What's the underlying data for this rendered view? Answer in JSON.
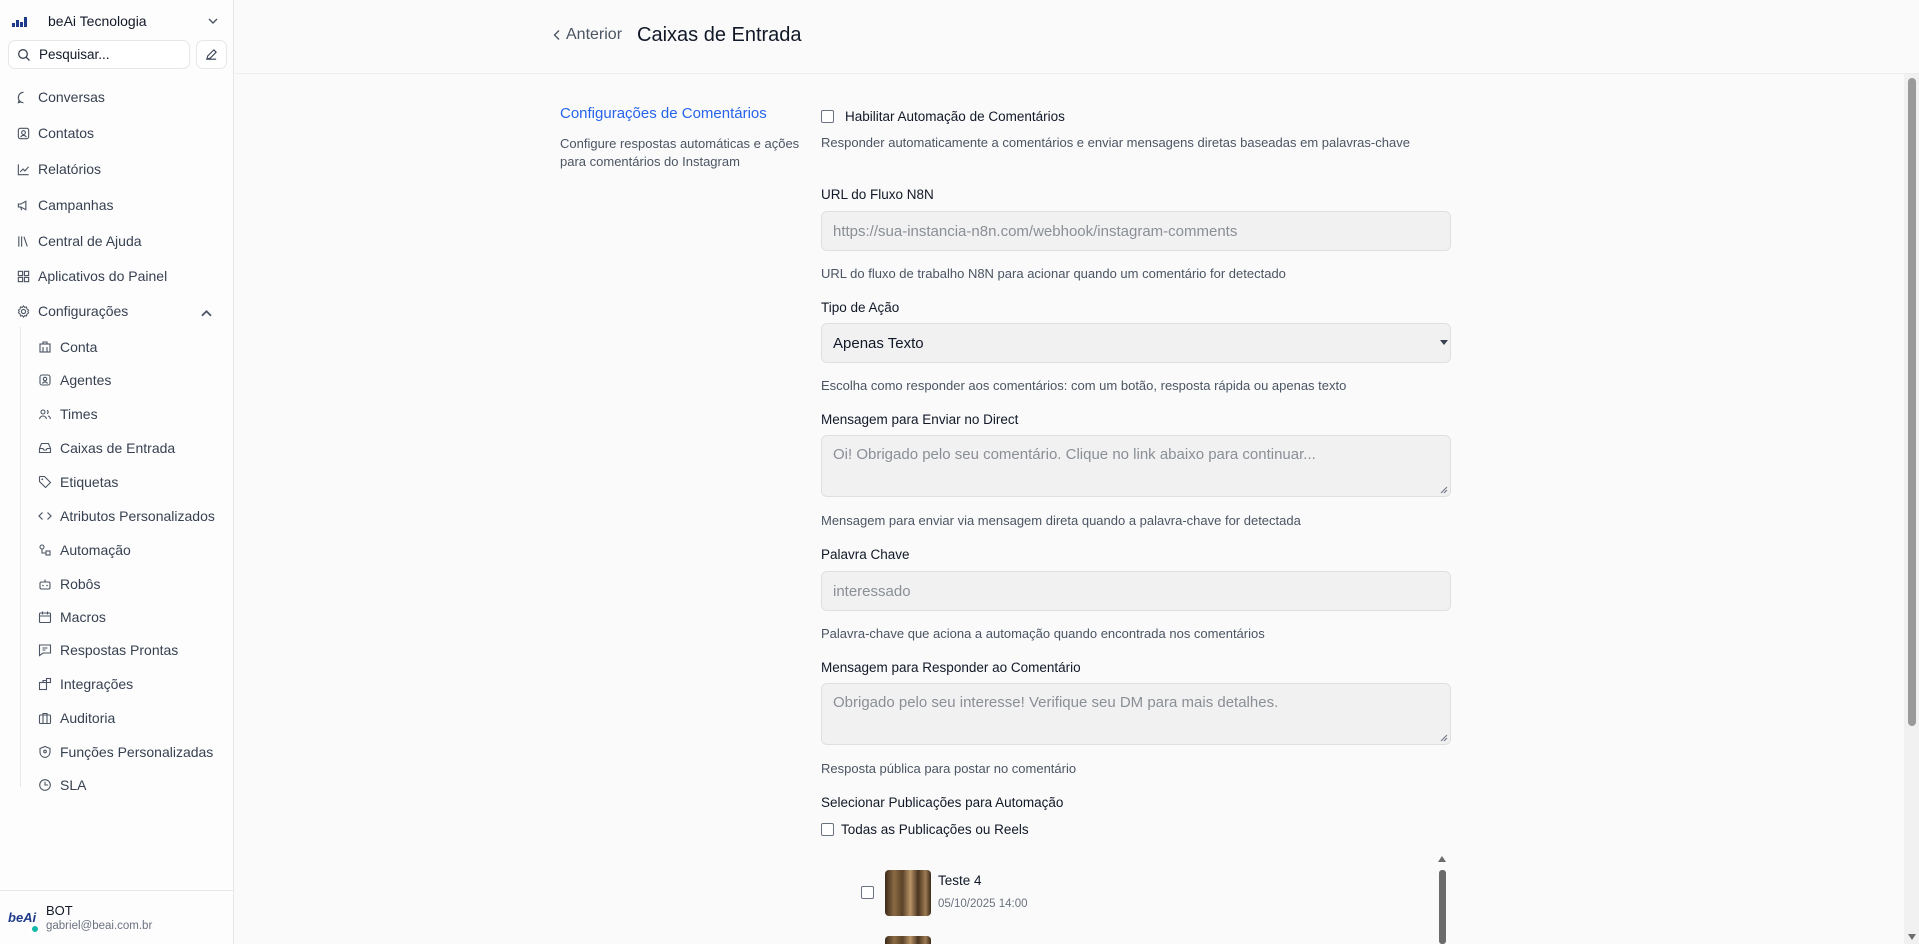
{
  "sidebar": {
    "org_name": "beAi Tecnologia",
    "search_placeholder": "Pesquisar...",
    "nav": [
      {
        "label": "Conversas",
        "icon": "chat-bubble-icon"
      },
      {
        "label": "Contatos",
        "icon": "contact-card-icon"
      },
      {
        "label": "Relatórios",
        "icon": "chart-line-icon"
      },
      {
        "label": "Campanhas",
        "icon": "megaphone-icon"
      },
      {
        "label": "Central de Ajuda",
        "icon": "library-icon"
      },
      {
        "label": "Aplicativos do Painel",
        "icon": "apps-grid-icon"
      },
      {
        "label": "Configurações",
        "icon": "gear-icon"
      }
    ],
    "settings_items": [
      {
        "label": "Conta",
        "icon": "building-icon"
      },
      {
        "label": "Agentes",
        "icon": "agent-icon"
      },
      {
        "label": "Times",
        "icon": "users-icon"
      },
      {
        "label": "Caixas de Entrada",
        "icon": "inbox-icon"
      },
      {
        "label": "Etiquetas",
        "icon": "tag-icon"
      },
      {
        "label": "Atributos Personalizados",
        "icon": "code-icon"
      },
      {
        "label": "Automação",
        "icon": "automation-icon"
      },
      {
        "label": "Robôs",
        "icon": "bot-icon"
      },
      {
        "label": "Macros",
        "icon": "calendar-icon"
      },
      {
        "label": "Respostas Prontas",
        "icon": "message-reply-icon"
      },
      {
        "label": "Integrações",
        "icon": "puzzle-icon"
      },
      {
        "label": "Auditoria",
        "icon": "briefcase-icon"
      },
      {
        "label": "Funções Personalizadas",
        "icon": "shield-icon"
      },
      {
        "label": "SLA",
        "icon": "clock-icon"
      }
    ],
    "user": {
      "name": "BOT",
      "email": "gabriel@beai.com.br",
      "avatar_text": "beAi"
    }
  },
  "header": {
    "back_label": "Anterior",
    "title": "Caixas de Entrada"
  },
  "section": {
    "title": "Configurações de Comentários",
    "description": "Configure respostas automáticas e ações para comentários do Instagram"
  },
  "form": {
    "enable_label": "Habilitar Automação de Comentários",
    "enable_help": "Responder automaticamente a comentários e enviar mensagens diretas baseadas em palavras-chave",
    "n8n_label": "URL do Fluxo N8N",
    "n8n_placeholder": "https://sua-instancia-n8n.com/webhook/instagram-comments",
    "n8n_help": "URL do fluxo de trabalho N8N para acionar quando um comentário for detectado",
    "action_label": "Tipo de Ação",
    "action_value": "Apenas Texto",
    "action_help": "Escolha como responder aos comentários: com um botão, resposta rápida ou apenas texto",
    "direct_label": "Mensagem para Enviar no Direct",
    "direct_placeholder": "Oi! Obrigado pelo seu comentário. Clique no link abaixo para continuar...",
    "direct_help": "Mensagem para enviar via mensagem direta quando a palavra-chave for detectada",
    "keyword_label": "Palavra Chave",
    "keyword_placeholder": "interessado",
    "keyword_help": "Palavra-chave que aciona a automação quando encontrada nos comentários",
    "reply_label": "Mensagem para Responder ao Comentário",
    "reply_placeholder": "Obrigado pelo seu interesse! Verifique seu DM para mais detalhes.",
    "reply_help": "Resposta pública para postar no comentário",
    "posts_label": "Selecionar Publicações para Automação",
    "all_posts_label": "Todas as Publicações ou Reels",
    "posts": [
      {
        "title": "Teste 4",
        "date": "05/10/2025 14:00"
      }
    ]
  }
}
